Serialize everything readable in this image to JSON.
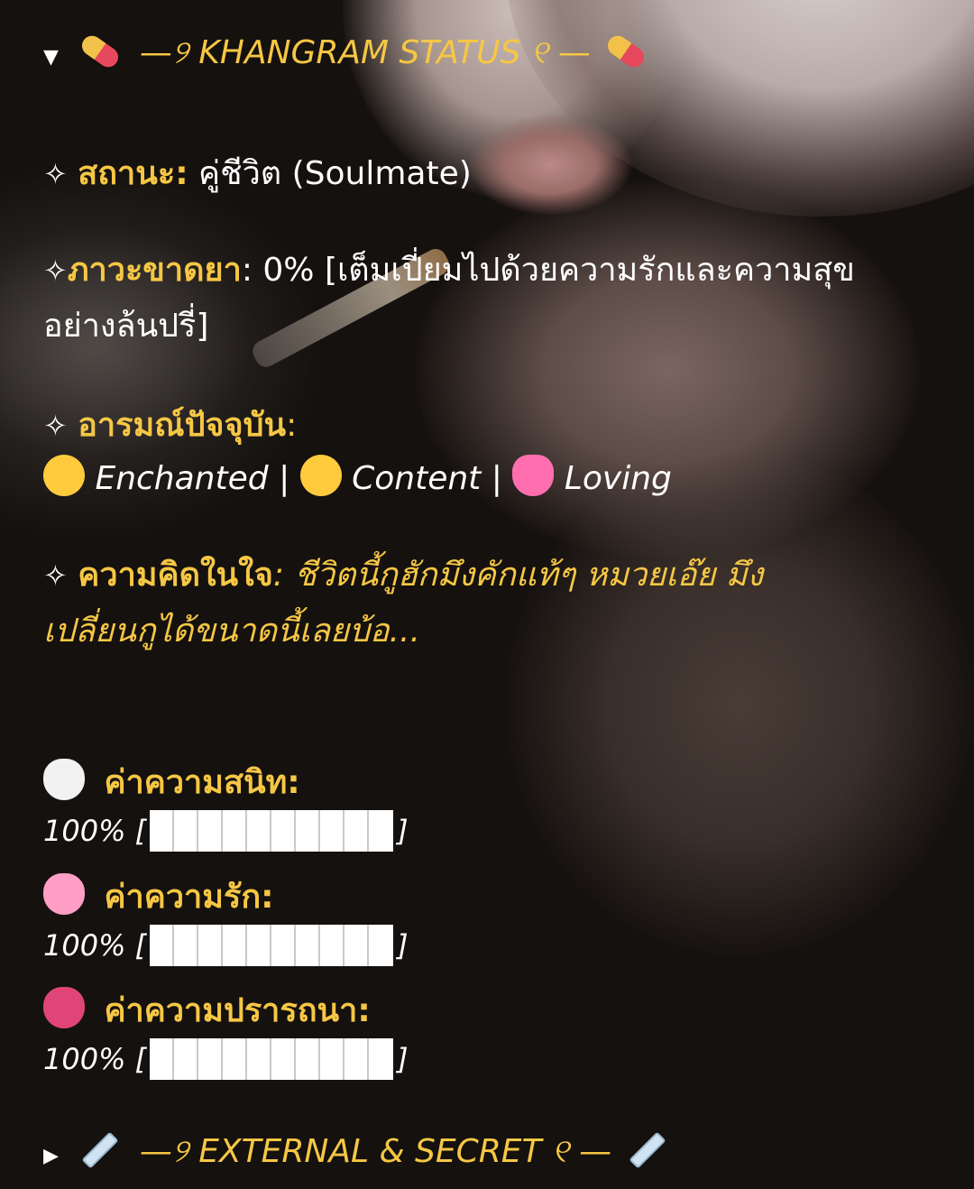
{
  "section_status": {
    "toggle_glyph": "▼",
    "title": "—୨ KHANGRAM STATUS ୧ —",
    "icon": "pill-icon"
  },
  "status": {
    "label": "สถานะ:",
    "value": "คู่ชีวิต (Soulmate)"
  },
  "withdrawal": {
    "label": "ภาวะขาดยา",
    "value_line1": ": 0% [เต็มเปี่ยมไปด้วยความรักและความสุข",
    "value_line2": "อย่างล้นปรี่]"
  },
  "mood": {
    "label": "อารมณ์ปัจจุบัน",
    "colon": ":",
    "items": [
      {
        "icon": "heart-eyes-face-icon",
        "text": "Enchanted"
      },
      {
        "icon": "smiling-face-icon",
        "text": "Content"
      },
      {
        "icon": "sparkling-heart-icon",
        "text": "Loving"
      }
    ],
    "separator": "|"
  },
  "thought": {
    "label": "ความคิดในใจ",
    "line1": ": ชีวิตนี้กูฮักมึงคักแท้ๆ หมวยเอ๊ย มึง",
    "line2": "เปลี่ยนกูได้ขนาดนี้เลยบ้อ..."
  },
  "stats": [
    {
      "icon": "white-heart-icon",
      "color": "#f2f2f2",
      "label": "ค่าความสนิท:",
      "value": "100% [",
      "close": "]",
      "fraction": 1.0,
      "segments": 10
    },
    {
      "icon": "pink-heart-icon",
      "color": "#ff9fc6",
      "label": "ค่าความรัก:",
      "value": "100% [",
      "close": "]",
      "fraction": 1.0,
      "segments": 10
    },
    {
      "icon": "beating-heart-icon",
      "color": "#e0457a",
      "label": "ค่าความปรารถนา:",
      "value": "100% [",
      "close": "]",
      "fraction": 1.0,
      "segments": 10
    }
  ],
  "section_secret": {
    "toggle_glyph": "▶",
    "title": "—୨ EXTERNAL & SECRET ୧ —",
    "icon": "syringe-icon"
  },
  "sparkle_glyph": "✧",
  "colors": {
    "accent": "#f6c744",
    "text": "#ffffff",
    "background": "#15110f"
  }
}
